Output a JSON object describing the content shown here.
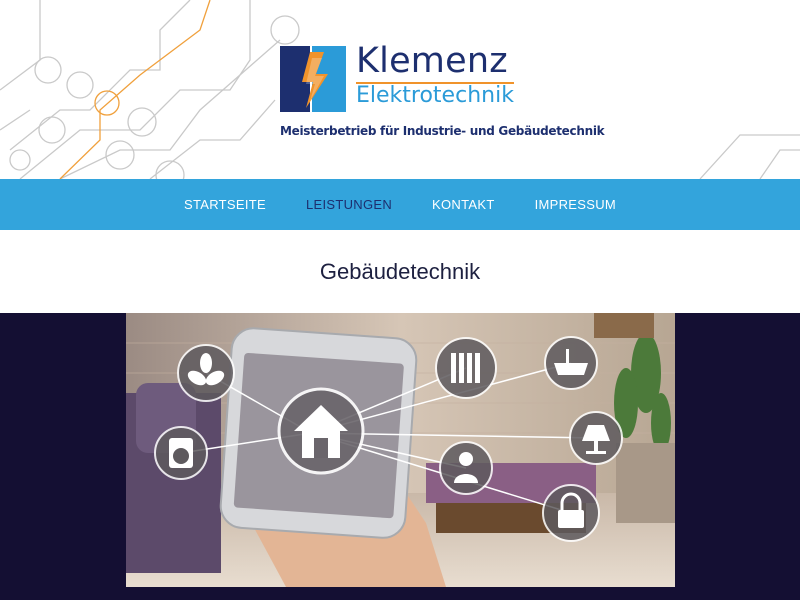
{
  "brand": {
    "name": "Klemenz",
    "subtitle": "Elektrotechnik",
    "tagline": "Meisterbetrieb für Industrie- und Gebäudetechnik",
    "colors": {
      "navy": "#1d2f6f",
      "blue": "#2b9bd8",
      "orange": "#f0932b"
    }
  },
  "nav": {
    "items": [
      {
        "label": "STARTSEITE"
      },
      {
        "label": "LEISTUNGEN"
      },
      {
        "label": "KONTAKT"
      },
      {
        "label": "IMPRESSUM"
      }
    ],
    "active": "LEISTUNGEN",
    "background": "#33a4dc"
  },
  "page": {
    "title": "Gebäudetechnik"
  },
  "hero": {
    "background": "#140f33",
    "icons": [
      "fan-icon",
      "washing-machine-icon",
      "house-icon",
      "radiator-icon",
      "bathtub-icon",
      "lamp-icon",
      "person-icon",
      "lock-icon"
    ]
  }
}
